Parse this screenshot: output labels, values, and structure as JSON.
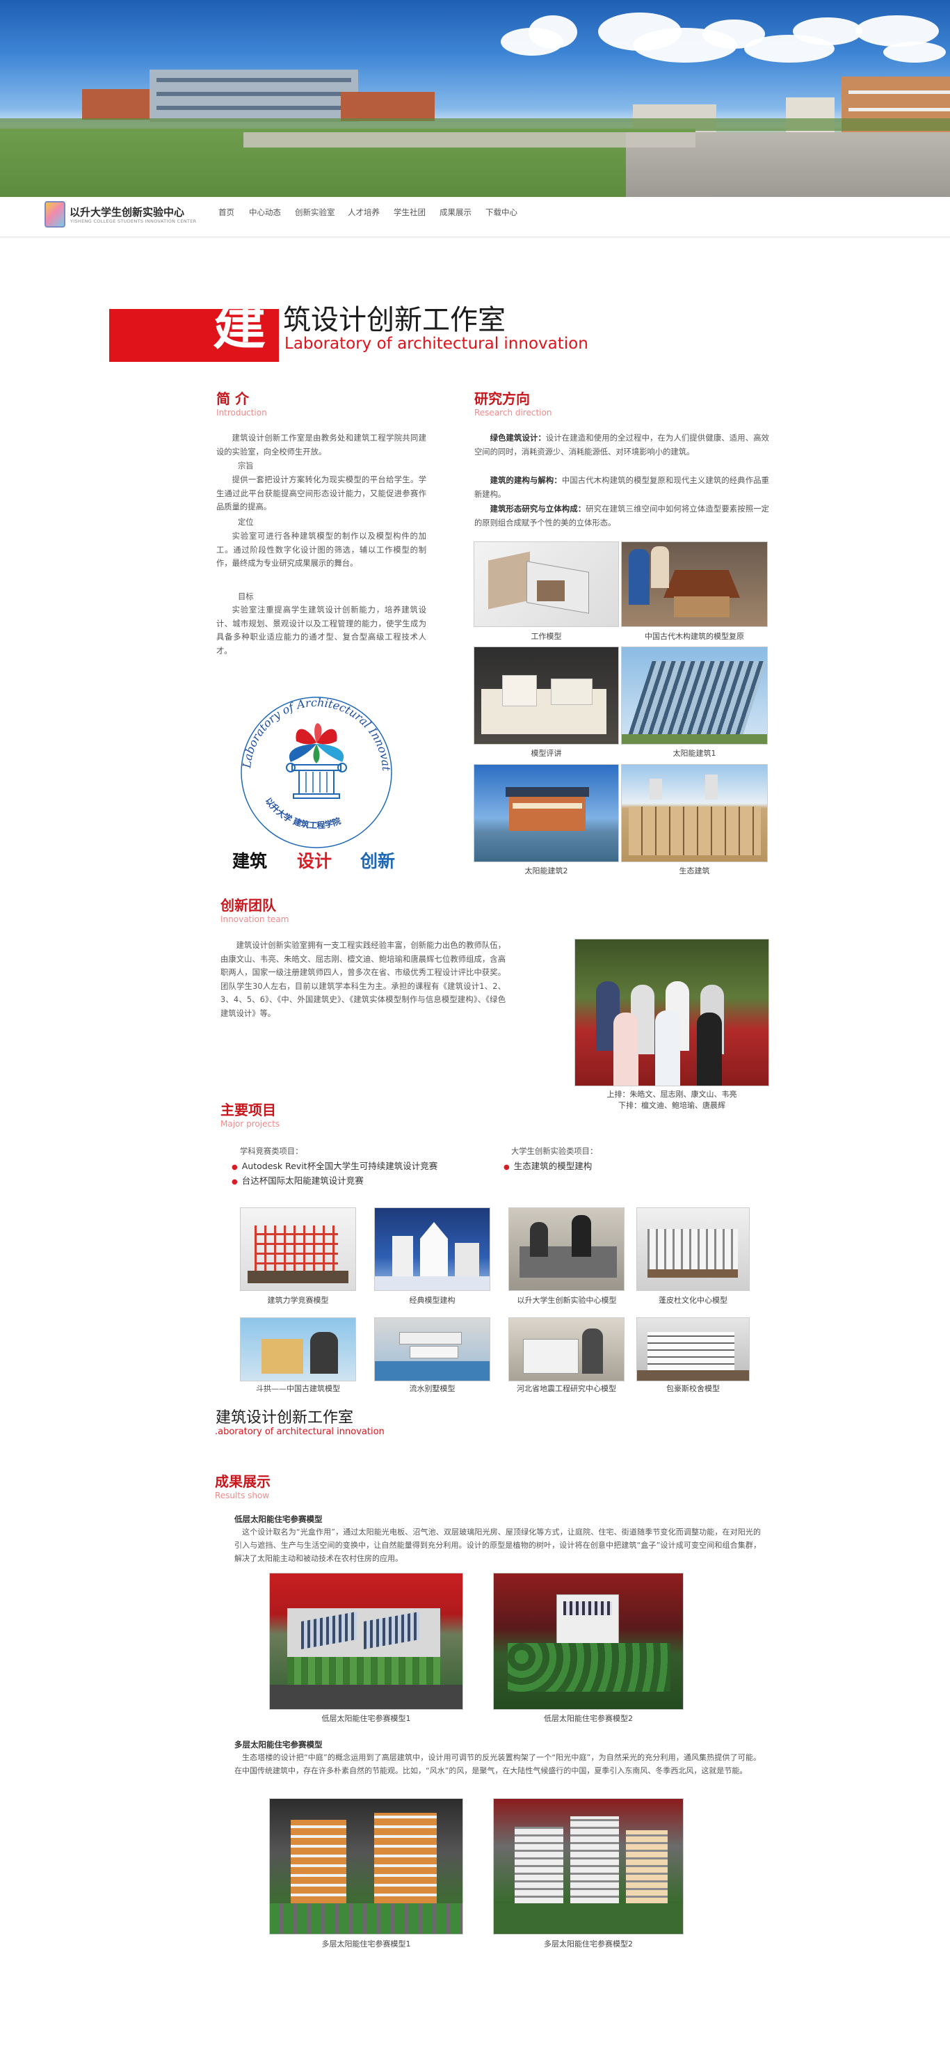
{
  "nav": {
    "logo_name": "以升大学生创新实验中心",
    "logo_en": "YISHENG COLLEGE STUDENTS INNOVATION CENTER",
    "items": [
      "首页",
      "中心动态",
      "创新实验室",
      "人才培养",
      "学生社团",
      "成果展示",
      "下载中心"
    ]
  },
  "title": {
    "first_char": "建",
    "rest": "筑设计创新工作室",
    "en": "Laboratory of architectural innovation"
  },
  "intro": {
    "title": "简 介",
    "en": "Introduction",
    "p1": "建筑设计创新工作室是由教务处和建筑工程学院共同建设的实验室，向全校师生开放。",
    "h1": "宗旨",
    "p2": "提供一套把设计方案转化为现实模型的平台给学生。学生通过此平台获能提高空间形态设计能力，又能促进参赛作品质量的提高。",
    "h2": "定位",
    "p3": "实验室可进行各种建筑模型的制作以及模型构件的加工。通过阶段性数字化设计图的筛选，辅以工作模型的制作，最终成为专业研究成果展示的舞台。",
    "h3": "目标",
    "p4": "实验室注重提高学生建筑设计创新能力，培养建筑设计、城市规划、景观设计以及工程管理的能力，使学生成为具备多种职业适应能力的通才型、复合型高级工程技术人才。"
  },
  "emblem": {
    "ring_text": "Laboratory of Architectural Innovation",
    "ring_cn": "以升大学  建筑工程学院",
    "words": [
      "建筑",
      "设计",
      "创新"
    ],
    "colors": [
      "#111111",
      "#d81c23",
      "#1f68b8"
    ]
  },
  "research": {
    "title": "研究方向",
    "en": "Research direction",
    "items": [
      {
        "label": "绿色建筑设计：",
        "text": "设计在建造和使用的全过程中，在为人们提供健康、适用、高效空间的同时，消耗资源少、消耗能源低、对环境影响小的建筑。"
      },
      {
        "label": "建筑的建构与解构：",
        "text": "中国古代木构建筑的模型复原和现代主义建筑的经典作品重新建构。"
      },
      {
        "label": "建筑形态研究与立体构成：",
        "text": "研究在建筑三维空间中如何将立体造型要素按照一定的原则组合成赋予个性的美的立体形态。"
      }
    ],
    "photos": [
      "工作模型",
      "中国古代木构建筑的模型复原",
      "模型评讲",
      "太阳能建筑1",
      "太阳能建筑2",
      "生态建筑"
    ]
  },
  "team": {
    "title": "创新团队",
    "en": "Innovation team",
    "text": "建筑设计创新实验室拥有一支工程实践经验丰富，创新能力出色的教师队伍，由康文山、韦亮、朱皓文、屈志刚、檀文迪、鲍培瑜和唐晨辉七位教师组成，含高职两人，国家一级注册建筑师四人，曾多次在省、市级优秀工程设计评比中获奖。团队学生30人左右，目前以建筑学本科生为主。承担的课程有《建筑设计1、2、3、4、5、6》、《中、外国建筑史》、《建筑实体模型制作与信息模型建构》、《绿色建筑设计》等。",
    "caption1": "上排：朱皓文、屈志刚、康文山、韦亮",
    "caption2": "下排：檀文迪、鲍培瑜、唐晨辉"
  },
  "projects": {
    "title": "主要项目",
    "en": "Major projects",
    "col1_head": "学科竞赛类项目：",
    "col1": [
      "Autodesk Revit杯全国大学生可持续建筑设计竞赛",
      "台达杯国际太阳能建筑设计竞赛"
    ],
    "col2_head": "大学生创新实验类项目：",
    "col2": [
      "生态建筑的模型建构"
    ],
    "photos": [
      "建筑力学竞赛模型",
      "经典模型建构",
      "以升大学生创新实验中心模型",
      "蓬皮杜文化中心模型",
      "斗拱——中国古建筑模型",
      "流水别墅模型",
      "河北省地震工程研究中心模型",
      "包豪斯校舍模型"
    ]
  },
  "subtitle": {
    "cn": "建筑设计创新工作室",
    "en": ".aboratory of architectural innovation"
  },
  "results": {
    "title": "成果展示",
    "en": "Results show",
    "g1_title": "低层太阳能住宅参赛模型",
    "g1_text": "这个设计取名为“光盒作用”，通过太阳能光电板、沼气池、双层玻璃阳光房、屋顶绿化等方式，让庭院、住宅、街道随季节变化而调整功能，在对阳光的引入与遮挡、生产与生活空间的变换中，让自然能量得到充分利用。设计的原型是植物的树叶，设计将在创意中把建筑“盒子”设计成可变空间和组合集群，解决了太阳能主动和被动技术在农村住房的应用。",
    "g1_caps": [
      "低层太阳能住宅参赛模型1",
      "低层太阳能住宅参赛模型2"
    ],
    "g2_title": "多层太阳能住宅参赛模型",
    "g2_text": "生态塔楼的设计把“中庭”的概念运用到了高层建筑中，设计用可调节的反光装置构架了一个“阳光中庭”，为自然采光的充分利用，通风集热提供了可能。在中国传统建筑中，存在许多朴素自然的节能观。比如，“风水”的风，是聚气，在大陆性气候盛行的中国，夏季引入东南风、冬季西北风，这就是节能。",
    "g2_caps": [
      "多层太阳能住宅参赛模型1",
      "多层太阳能住宅参赛模型2"
    ]
  }
}
